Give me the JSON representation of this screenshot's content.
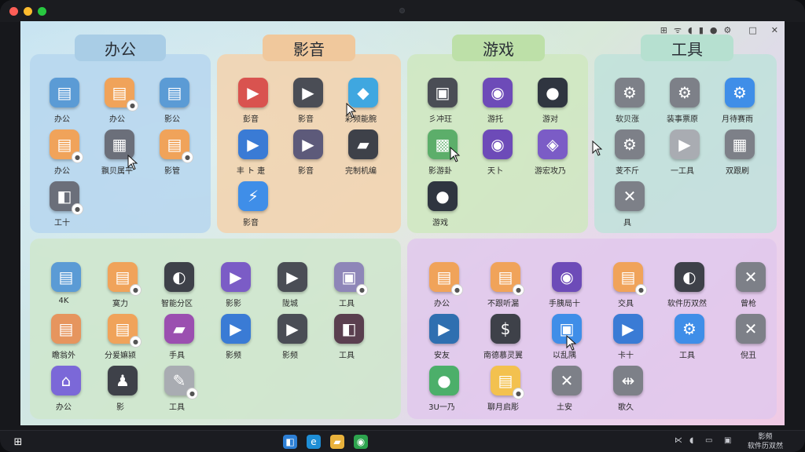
{
  "window": {
    "controls": [
      {
        "name": "close-dot",
        "color": "#ff5f57"
      },
      {
        "name": "minimize-dot",
        "color": "#febc2e"
      },
      {
        "name": "maximize-dot",
        "color": "#28c840"
      }
    ]
  },
  "top_tray": {
    "icons": [
      "grid-icon",
      "wifi-icon",
      "speaker-icon",
      "battery-icon",
      "mic-icon",
      "settings-icon"
    ],
    "restore_label": "□",
    "close_label": "✕"
  },
  "headings": [
    {
      "text": "办公",
      "color": "#a9cde6"
    },
    {
      "text": "影音",
      "color": "#f0c89c"
    },
    {
      "text": "游戏",
      "color": "#bde0a8"
    },
    {
      "text": "工具",
      "color": "#b6e0d0"
    }
  ],
  "sections": [
    {
      "color": "#b6d6ee"
    },
    {
      "color": "#f3d2ad"
    },
    {
      "color": "#cfe8bf"
    },
    {
      "color": "#bfe2db"
    },
    {
      "color": "#cfe6cc"
    },
    {
      "color": "#e1c8ec"
    }
  ],
  "apps": {
    "office": [
      {
        "label": "办公",
        "icon": "ppt-icon",
        "glyph": "▤",
        "color": "#5b9bd5",
        "badge": false
      },
      {
        "label": "办公",
        "icon": "document-icon",
        "glyph": "▤",
        "color": "#f0a35a",
        "badge": true
      },
      {
        "label": "影公",
        "icon": "presentation-icon",
        "glyph": "▤",
        "color": "#5b9bd5",
        "badge": false
      },
      {
        "label": "办公",
        "icon": "document-icon",
        "glyph": "▤",
        "color": "#f0a35a",
        "badge": true
      },
      {
        "label": "飘贝属平",
        "icon": "spreadsheet-icon",
        "glyph": "▦",
        "color": "#6b6f7a",
        "badge": false
      },
      {
        "label": "影管",
        "icon": "document-icon",
        "glyph": "▤",
        "color": "#f0a35a",
        "badge": true
      },
      {
        "label": "工十",
        "icon": "tools-doc-icon",
        "glyph": "◧",
        "color": "#6b6f7a",
        "badge": true
      }
    ],
    "media": [
      {
        "label": "彭音",
        "icon": "film-icon",
        "glyph": "▶",
        "color": "#d9534f",
        "badge": false
      },
      {
        "label": "影音",
        "icon": "play-icon",
        "glyph": "▶",
        "color": "#4a4d55",
        "badge": false
      },
      {
        "label": "彩频能腕",
        "icon": "media-icon",
        "glyph": "◆",
        "color": "#3fa7e0",
        "badge": false
      },
      {
        "label": "丰 ト 疌",
        "icon": "play-icon",
        "glyph": "▶",
        "color": "#3a7bd5",
        "badge": false
      },
      {
        "label": "影音",
        "icon": "play-icon",
        "glyph": "▶",
        "color": "#5d5a7a",
        "badge": false
      },
      {
        "label": "完制机编",
        "icon": "video-editor-icon",
        "glyph": "▰",
        "color": "#3e4149",
        "badge": false
      },
      {
        "label": "影音",
        "icon": "lightning-icon",
        "glyph": "⚡",
        "color": "#3f8ee8",
        "badge": false
      }
    ],
    "games": [
      {
        "label": "彡冲玨",
        "icon": "film-strip-icon",
        "glyph": "▣",
        "color": "#4a4d55",
        "badge": false
      },
      {
        "label": "游托",
        "icon": "gamepad-icon",
        "glyph": "◉",
        "color": "#6d4bb8",
        "badge": false
      },
      {
        "label": "游对",
        "icon": "fire-icon",
        "glyph": "●",
        "color": "#2f3540",
        "badge": false
      },
      {
        "label": "影游卦",
        "icon": "puzzle-icon",
        "glyph": "▩",
        "color": "#5cae6a",
        "badge": false
      },
      {
        "label": "天卜",
        "icon": "gamepad-icon",
        "glyph": "◉",
        "color": "#6d4bb8",
        "badge": false
      },
      {
        "label": "游宏攻乃",
        "icon": "map-icon",
        "glyph": "◈",
        "color": "#7b5cc6",
        "badge": false
      },
      {
        "label": "游戏",
        "icon": "character-icon",
        "glyph": "●",
        "color": "#2f3540",
        "badge": false
      }
    ],
    "tools": [
      {
        "label": "软贝涨",
        "icon": "gear-icon",
        "glyph": "⚙",
        "color": "#7d8088",
        "badge": false
      },
      {
        "label": "装事票原",
        "icon": "gear-icon",
        "glyph": "⚙",
        "color": "#7d8088",
        "badge": false
      },
      {
        "label": "月待赛雨",
        "icon": "gear-icon",
        "glyph": "⚙",
        "color": "#3f8ee8",
        "badge": false
      },
      {
        "label": "芰不斤",
        "icon": "gear-icon",
        "glyph": "⚙",
        "color": "#7d8088",
        "badge": false
      },
      {
        "label": "一工具",
        "icon": "play-outline-icon",
        "glyph": "▶",
        "color": "#a9acb2",
        "badge": false
      },
      {
        "label": "双跟刷",
        "icon": "grid-tools-icon",
        "glyph": "▦",
        "color": "#7d8088",
        "badge": false
      },
      {
        "label": "具",
        "icon": "wrench-icon",
        "glyph": "✕",
        "color": "#7d8088",
        "badge": false
      }
    ],
    "lower_left": [
      {
        "label": "4K",
        "icon": "presentation-icon",
        "glyph": "▤",
        "color": "#5b9bd5",
        "badge": false
      },
      {
        "label": "寞力",
        "icon": "document-icon",
        "glyph": "▤",
        "color": "#f0a35a",
        "badge": true
      },
      {
        "label": "智能分区",
        "icon": "camera-icon",
        "glyph": "◐",
        "color": "#3e4149",
        "badge": false
      },
      {
        "label": "影影",
        "icon": "tv-icon",
        "glyph": "▶",
        "color": "#7b5cc6",
        "badge": false
      },
      {
        "label": "陇城",
        "icon": "play-icon",
        "glyph": "▶",
        "color": "#4a4d55",
        "badge": false
      },
      {
        "label": "工具",
        "icon": "device-icon",
        "glyph": "▣",
        "color": "#8e86b8",
        "badge": true
      },
      {
        "label": "瞻翁外",
        "icon": "document-icon",
        "glyph": "▤",
        "color": "#e6955e",
        "badge": false
      },
      {
        "label": "分爰嫲颍",
        "icon": "document-icon",
        "glyph": "▤",
        "color": "#f0a35a",
        "badge": true
      },
      {
        "label": "手具",
        "icon": "film-icon",
        "glyph": "▰",
        "color": "#9b4fb0",
        "badge": false
      },
      {
        "label": "影频",
        "icon": "play-icon",
        "glyph": "▶",
        "color": "#3a7bd5",
        "badge": false
      },
      {
        "label": "影频",
        "icon": "play-icon",
        "glyph": "▶",
        "color": "#4a4d55",
        "badge": false
      },
      {
        "label": "工具",
        "icon": "tools-doc-icon",
        "glyph": "◧",
        "color": "#5a3f4f",
        "badge": false
      },
      {
        "label": "办公",
        "icon": "home-icon",
        "glyph": "⌂",
        "color": "#7b68d8",
        "badge": false
      },
      {
        "label": "影",
        "icon": "figure-icon",
        "glyph": "♟",
        "color": "#3e4149",
        "badge": false
      },
      {
        "label": "工具",
        "icon": "pen-tool-icon",
        "glyph": "✎",
        "color": "#a9acb2",
        "badge": true
      }
    ],
    "lower_right": [
      {
        "label": "办公",
        "icon": "document-icon",
        "glyph": "▤",
        "color": "#f0a35a",
        "badge": true
      },
      {
        "label": "不跟听漏",
        "icon": "document-icon",
        "glyph": "▤",
        "color": "#f0a35a",
        "badge": true
      },
      {
        "label": "手胰局十",
        "icon": "gamepad-icon",
        "glyph": "◉",
        "color": "#6d4bb8",
        "badge": false
      },
      {
        "label": "交具",
        "icon": "document-icon",
        "glyph": "▤",
        "color": "#f0a35a",
        "badge": true
      },
      {
        "label": "软件历双然",
        "icon": "camera-icon",
        "glyph": "◐",
        "color": "#3e4149",
        "badge": false
      },
      {
        "label": "曾枪",
        "icon": "wrench-icon",
        "glyph": "✕",
        "color": "#7d8088",
        "badge": false
      },
      {
        "label": "安友",
        "icon": "media-icon",
        "glyph": "▶",
        "color": "#2f6fb0",
        "badge": false
      },
      {
        "label": "南德慕灵翼",
        "icon": "dollar-icon",
        "glyph": "$",
        "color": "#3e4149",
        "badge": false
      },
      {
        "label": "以乱隅",
        "icon": "photos-icon",
        "glyph": "▣",
        "color": "#3f8ee8",
        "badge": false
      },
      {
        "label": "卡十",
        "icon": "play-icon",
        "glyph": "▶",
        "color": "#3a7bd5",
        "badge": false
      },
      {
        "label": "工具",
        "icon": "gear-icon",
        "glyph": "⚙",
        "color": "#3f8ee8",
        "badge": false
      },
      {
        "label": "倪丑",
        "icon": "wrench-icon",
        "glyph": "✕",
        "color": "#7d8088",
        "badge": false
      },
      {
        "label": "3U一乃",
        "icon": "contact-icon",
        "glyph": "●",
        "color": "#4caf6a",
        "badge": false
      },
      {
        "label": "聊月启彫",
        "icon": "document-icon",
        "glyph": "▤",
        "color": "#f3c14f",
        "badge": true
      },
      {
        "label": "土安",
        "icon": "wrench-icon",
        "glyph": "✕",
        "color": "#7d8088",
        "badge": false
      },
      {
        "label": "歌久",
        "icon": "dashes-icon",
        "glyph": "⇹",
        "color": "#7d8088",
        "badge": false
      }
    ]
  },
  "taskbar": {
    "start_icon": "windows-start-icon",
    "pinned": [
      {
        "icon": "task-view-icon",
        "glyph": "◧",
        "color": "#2d7fd5"
      },
      {
        "icon": "edge-browser-icon",
        "glyph": "e",
        "color": "#1e8ed6"
      },
      {
        "icon": "file-explorer-icon",
        "glyph": "▰",
        "color": "#e9b23c"
      },
      {
        "icon": "chrome-icon",
        "glyph": "◉",
        "color": "#2da44e"
      }
    ],
    "system_icons": [
      "network-icon",
      "volume-icon",
      "battery-icon",
      "notification-icon"
    ],
    "clock_line1": "影频",
    "clock_line2": "软件历双然"
  }
}
